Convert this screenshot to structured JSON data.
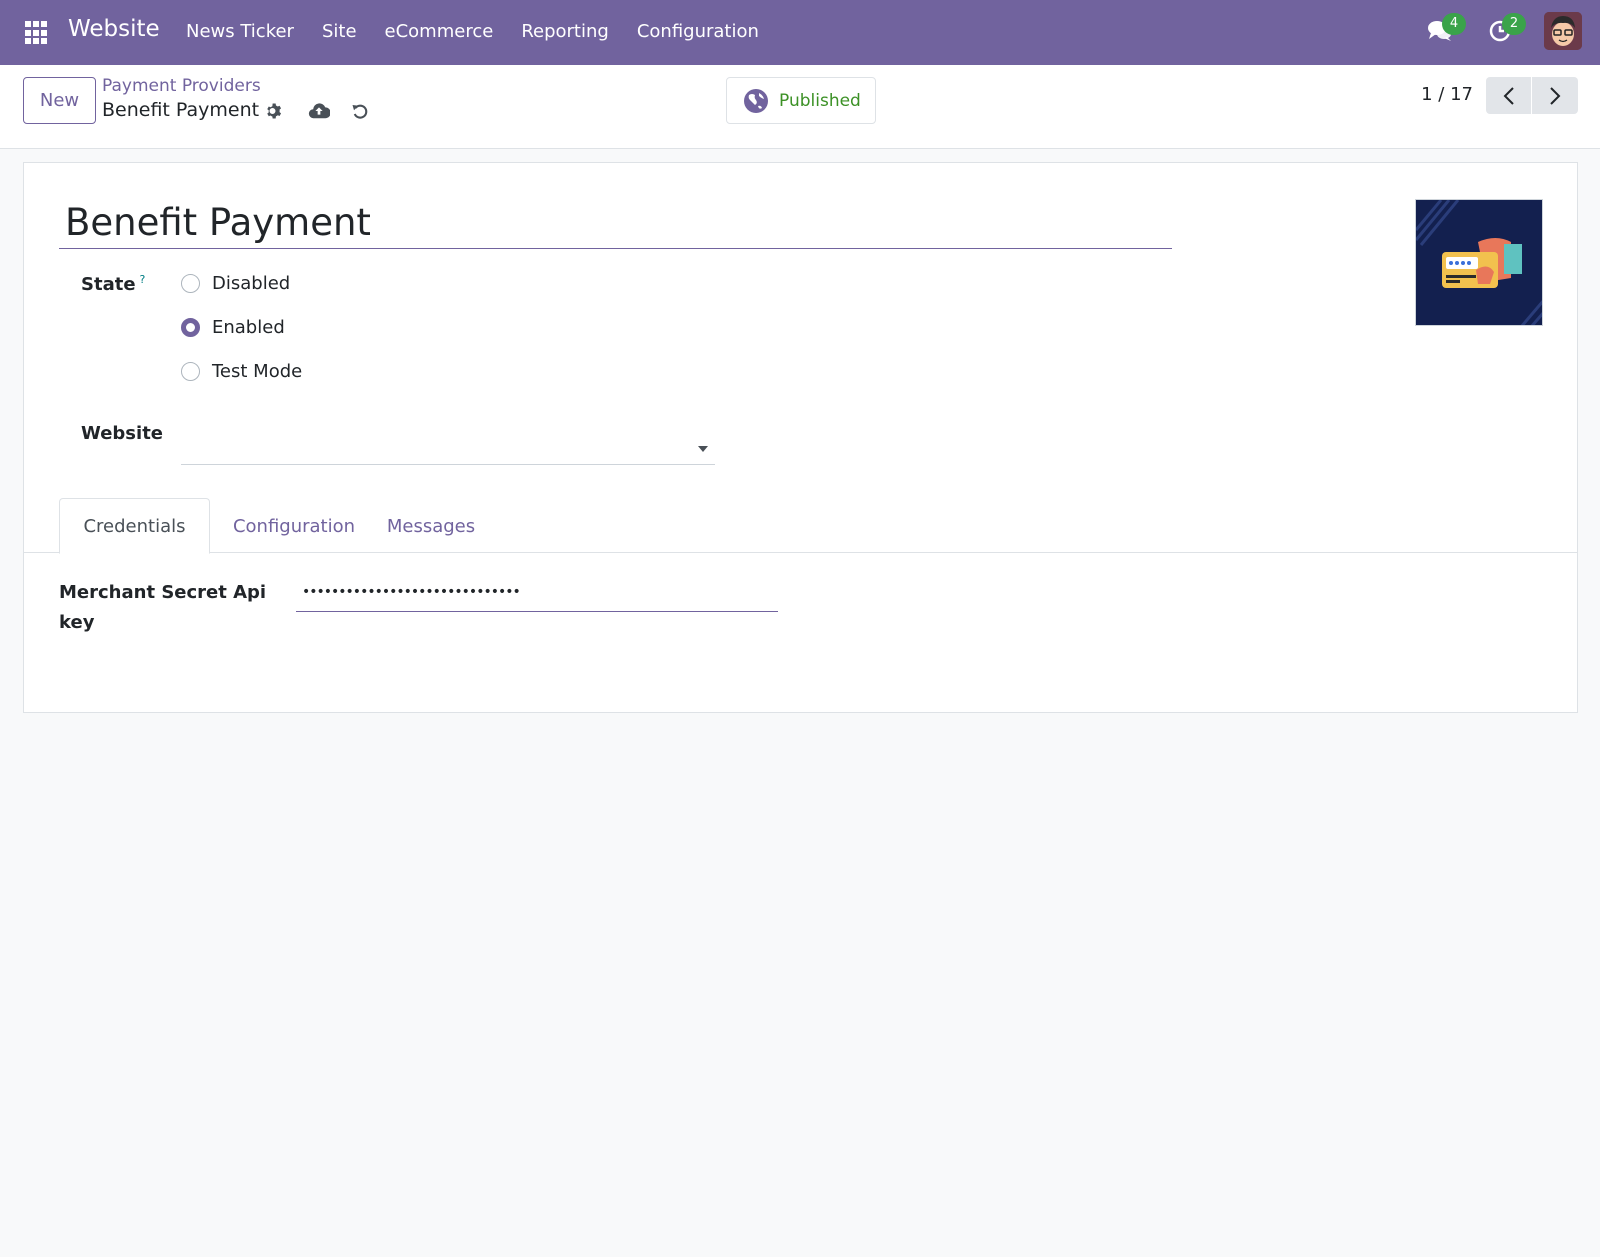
{
  "navbar": {
    "app_name": "Website",
    "menu": [
      "News Ticker",
      "Site",
      "eCommerce",
      "Reporting",
      "Configuration"
    ],
    "messages_badge": "4",
    "activities_badge": "2",
    "icons": {
      "apps": "grid-icon",
      "messages": "chat-bubbles-icon",
      "activities": "clock-icon",
      "avatar": "user-avatar"
    }
  },
  "control_panel": {
    "new_label": "New",
    "breadcrumb_parent": "Payment Providers",
    "breadcrumb_current": "Benefit Payment",
    "published_label": "Published",
    "pager_value": "1 / 17",
    "colors": {
      "brand": "#71639e",
      "published": "#3c9126",
      "badge": "#3aa34a"
    }
  },
  "form": {
    "title": "Benefit Payment",
    "state_label": "State",
    "state_help": "?",
    "state_options": [
      {
        "label": "Disabled",
        "checked": false
      },
      {
        "label": "Enabled",
        "checked": true
      },
      {
        "label": "Test Mode",
        "checked": false
      }
    ],
    "website_label": "Website",
    "website_value": "",
    "tabs": [
      {
        "label": "Credentials",
        "active": true
      },
      {
        "label": "Configuration",
        "active": false
      },
      {
        "label": "Messages",
        "active": false
      }
    ],
    "credentials": {
      "secret_label": "Merchant Secret Api key",
      "secret_value": "••••••••••••••••••••••••••••••"
    }
  }
}
